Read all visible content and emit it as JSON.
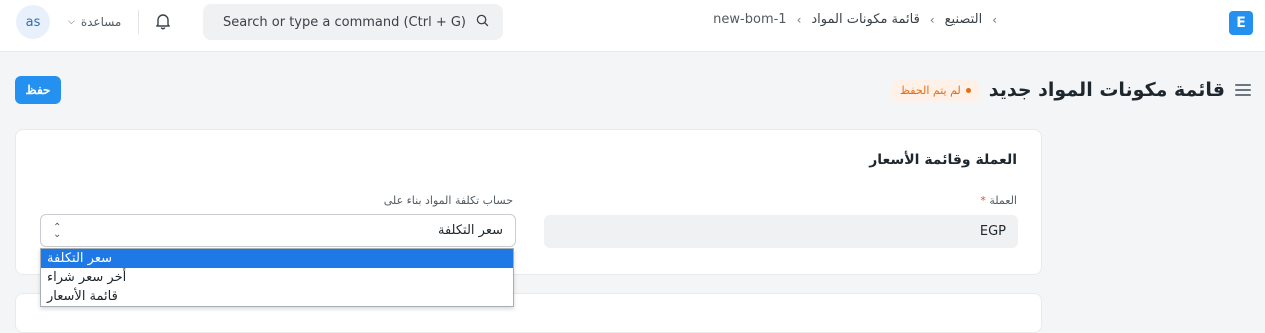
{
  "navbar": {
    "avatar_initials": "as",
    "help_label": "مساعدة",
    "search_placeholder": "Search or type a command (Ctrl + G)",
    "breadcrumbs": [
      "التصنيع",
      "قائمة مكونات المواد",
      "new-bom-1"
    ],
    "logo_letter": "E"
  },
  "page": {
    "title": "قائمة مكونات المواد جديد",
    "status_badge": "لم يتم الحفظ",
    "save_label": "حفظ"
  },
  "section": {
    "title": "العملة وقائمة الأسعار",
    "currency_label": "العملة",
    "currency_required_mark": "*",
    "currency_value": "EGP",
    "rm_cost_label": "حساب تكلفة المواد بناء على",
    "rm_cost_value": "سعر التكلفة",
    "rm_cost_options": [
      "سعر التكلفة",
      "أخر سعر شراء",
      "قائمة الأسعار"
    ]
  },
  "colors": {
    "primary": "#2490ef",
    "badge_text": "#e86c13",
    "badge_bg": "#fff1e7",
    "selected_option": "#1e78e6"
  }
}
